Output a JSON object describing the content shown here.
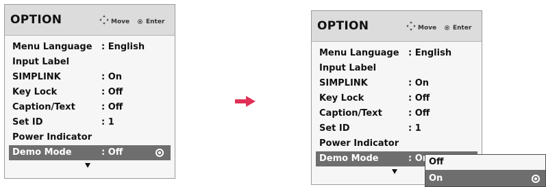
{
  "left_menu": {
    "title": "OPTION",
    "hint_move": "Move",
    "hint_enter": "Enter",
    "items": [
      {
        "label": "Menu Language",
        "value": ": English"
      },
      {
        "label": "Input Label",
        "value": ""
      },
      {
        "label": "SIMPLINK",
        "value": ": On"
      },
      {
        "label": "Key Lock",
        "value": ": Off"
      },
      {
        "label": "Caption/Text",
        "value": ": Off"
      },
      {
        "label": "Set ID",
        "value": ": 1"
      },
      {
        "label": "Power Indicator",
        "value": ""
      },
      {
        "label": "Demo Mode",
        "value": ": Off"
      }
    ],
    "selected_index": 7
  },
  "right_menu": {
    "title": "OPTION",
    "hint_move": "Move",
    "hint_enter": "Enter",
    "items": [
      {
        "label": "Menu Language",
        "value": ": English"
      },
      {
        "label": "Input Label",
        "value": ""
      },
      {
        "label": "SIMPLINK",
        "value": ": On"
      },
      {
        "label": "Key Lock",
        "value": ": Off"
      },
      {
        "label": "Caption/Text",
        "value": ": Off"
      },
      {
        "label": "Set ID",
        "value": ": 1"
      },
      {
        "label": "Power Indicator",
        "value": ""
      },
      {
        "label": "Demo Mode",
        "value": ": Or"
      }
    ],
    "selected_index": 7
  },
  "submenu": {
    "options": [
      "Off",
      "On"
    ],
    "selected": "On"
  },
  "colors": {
    "panel_bg": "#f6f6f6",
    "header_bg": "#dcdcdc",
    "selected_bg": "#6e6e6e",
    "arrow": "#e03055"
  },
  "icons": {
    "move": "move-arrows-icon",
    "enter": "enter-circle-icon",
    "transition": "right-arrow-icon",
    "scroll": "down-arrow-icon",
    "selected": "radio-icon"
  }
}
